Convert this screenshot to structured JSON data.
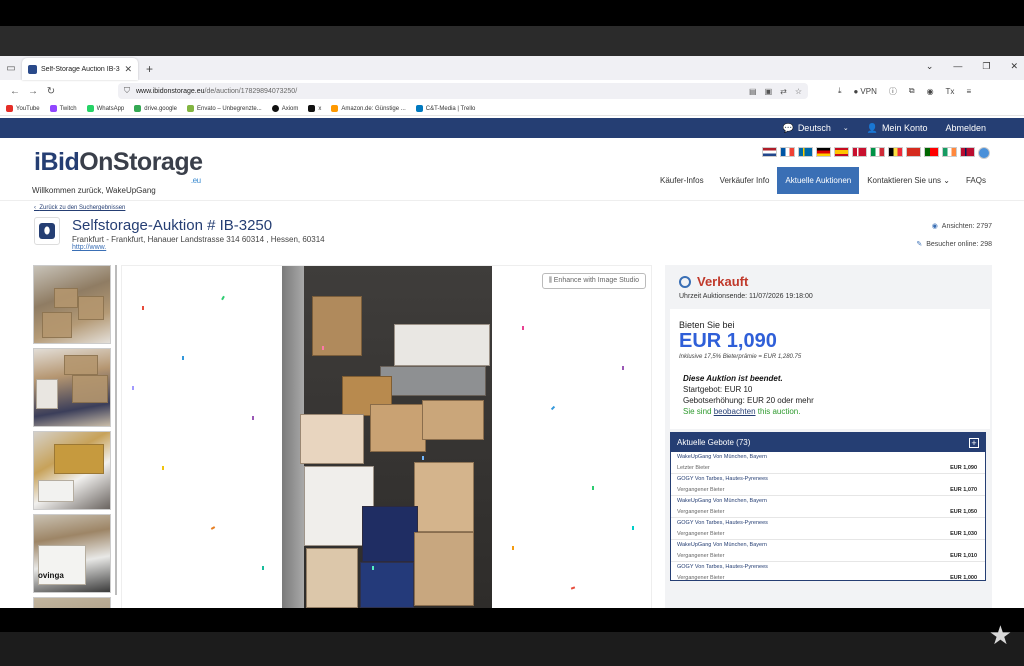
{
  "browser": {
    "tab_title": "Self-Storage Auction IB-3250 |",
    "url_host": "www.ibidonstorage.eu",
    "url_path": "/de/auction/17829894073250/",
    "vpn_label": "VPN",
    "bookmarks": [
      {
        "label": "YouTube",
        "color": "#e52d27"
      },
      {
        "label": "Twitch",
        "color": "#9146ff"
      },
      {
        "label": "WhatsApp",
        "color": "#25d366"
      },
      {
        "label": "drive.google",
        "color": "#34a853"
      },
      {
        "label": "Envato – Unbegrenzte...",
        "color": "#82b541"
      },
      {
        "label": "Axiom",
        "color": "#111111"
      },
      {
        "label": "x",
        "color": "#111111"
      },
      {
        "label": "Amazon.de: Günstige ...",
        "color": "#ff9900"
      },
      {
        "label": "C&T-Media | Trello",
        "color": "#0079bf"
      }
    ]
  },
  "site": {
    "topbar": {
      "language": "Deutsch",
      "account": "Mein Konto",
      "logout": "Abmelden"
    },
    "logo": {
      "part1": "iBid",
      "part2": "OnStorage",
      "suffix": ".eu"
    },
    "welcome": "Willkommen zurück, WakeUpGang",
    "nav": [
      "Käufer-Infos",
      "Verkäufer Info",
      "Aktuelle Auktionen",
      "Kontaktieren Sie uns",
      "FAQs"
    ],
    "back_link": "Zurück zu den Suchergebnissen",
    "auction": {
      "title": "Selfstorage-Auktion # IB-3250",
      "address": "Frankfurt - Frankfurt, Hanauer Landstrasse 314 60314 , Hessen, 60314",
      "link": "http://www.",
      "views": "Ansichten: 2797",
      "online": "Besucher online: 298"
    },
    "viewer": {
      "enhance_label": "Enhance with Image Studio",
      "thumb_label": "ovinga"
    },
    "panel": {
      "status": "Verkauft",
      "end_time": "Uhrzeit Auktionsende: 11/07/2026 19:18:00",
      "bid_label": "Bieten Sie bei",
      "bid_amount": "EUR 1,090",
      "premium": "Inklusive 17,5% Bieterprämie = EUR 1,280.75",
      "ended": "Diese Auktion ist beendet.",
      "start_bid": "Startgebot: EUR 10",
      "increment": "Gebotserhöhung: EUR 20 oder mehr",
      "watch_prefix": "Sie sind",
      "watch_link": "beobachten",
      "watch_suffix": "this auction.",
      "bids_header": "Aktuelle Gebote (73)",
      "bids": [
        {
          "bidder": "WakeUpGang Von München, Bayern",
          "status": "Letzter Bieter",
          "amount": "EUR 1,090"
        },
        {
          "bidder": "GOGY Von Tarbes, Hautes-Pyrenees",
          "status": "Vergangener Bieter",
          "amount": "EUR 1,070"
        },
        {
          "bidder": "WakeUpGang Von München, Bayern",
          "status": "Vergangener Bieter",
          "amount": "EUR 1,050"
        },
        {
          "bidder": "GOGY Von Tarbes, Hautes-Pyrenees",
          "status": "Vergangener Bieter",
          "amount": "EUR 1,030"
        },
        {
          "bidder": "WakeUpGang Von München, Bayern",
          "status": "Vergangener Bieter",
          "amount": "EUR 1,010"
        },
        {
          "bidder": "GOGY Von Tarbes, Hautes-Pyrenees",
          "status": "Vergangener Bieter",
          "amount": "EUR 1,000"
        }
      ]
    }
  },
  "colors": {
    "brand_navy": "#253e73",
    "accent_blue": "#3a6fb5",
    "sold_red": "#c0392b",
    "bid_blue": "#2f5fd8"
  }
}
